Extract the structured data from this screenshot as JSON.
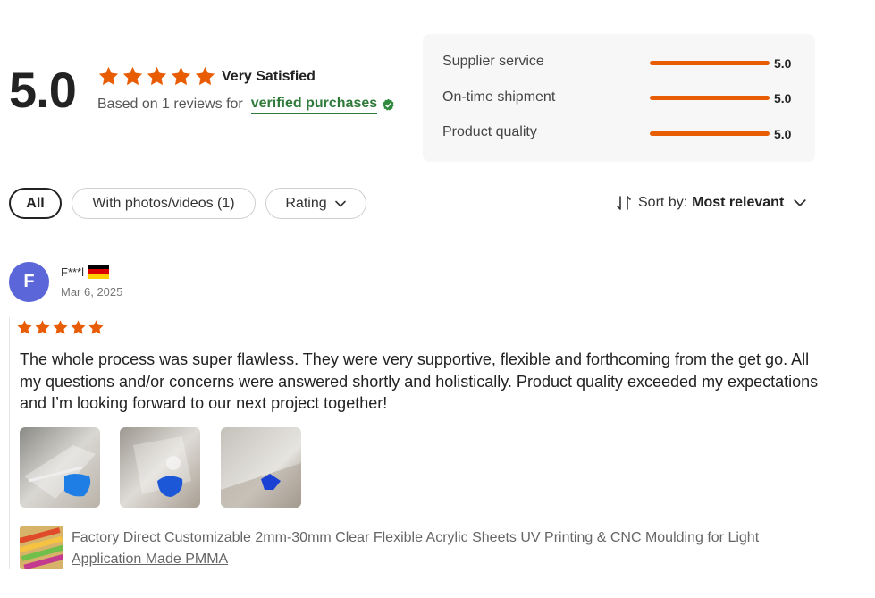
{
  "summary": {
    "score": "5.0",
    "stars": 5,
    "satisfaction": "Very Satisfied",
    "based_on": "Based on 1 reviews for",
    "verified": "verified purchases"
  },
  "breakdown": [
    {
      "label": "Supplier service",
      "value": "5.0",
      "fraction": 1.0
    },
    {
      "label": "On-time shipment",
      "value": "5.0",
      "fraction": 1.0
    },
    {
      "label": "Product quality",
      "value": "5.0",
      "fraction": 1.0
    }
  ],
  "filters": {
    "all": "All",
    "photos": "With photos/videos (1)",
    "rating": "Rating"
  },
  "sort": {
    "label": "Sort by:",
    "value": "Most relevant"
  },
  "review": {
    "avatar_letter": "F",
    "name": "F***l",
    "country_flag": "germany-flag-icon",
    "date": "Mar 6, 2025",
    "stars": 5,
    "text": "The whole process was super flawless. They were very supportive, flexible and forthcoming from the get go. All my questions and/or concerns were answered shortly and holistically. Product quality exceeded my expectations and I’m looking forward to our next project together!",
    "photos": [
      "review-photo-1",
      "review-photo-2",
      "review-photo-3"
    ],
    "product_title": "Factory Direct Customizable 2mm-30mm Clear Flexible Acrylic Sheets UV Printing & CNC Moulding for Light Application Made PMMA"
  },
  "colors": {
    "accent": "#e85d04",
    "verified_green": "#2f7a3a",
    "avatar": "#5b67d8"
  }
}
